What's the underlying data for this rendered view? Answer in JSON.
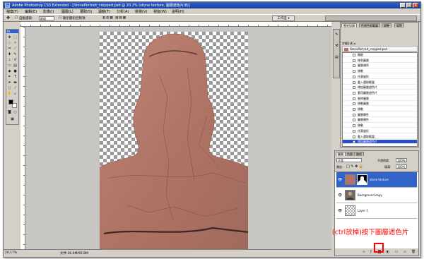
{
  "window": {
    "title": "Adobe Photoshop CS3 Extended - [StonePortrait_cropped.psd @ 20.2% (stone texture, 圖層遮色片/8)]",
    "app_icon": "Ps",
    "controls": [
      "_",
      "□",
      "×"
    ]
  },
  "menubar": {
    "items": [
      "檔案(F)",
      "編輯(E)",
      "影像(I)",
      "圖層(L)",
      "選取(S)",
      "濾鏡(T)",
      "分析(A)",
      "檢視(V)",
      "視窗(W)",
      "說明(H)"
    ]
  },
  "options_bar": {
    "auto_select_label": "自動選取:",
    "auto_select_value": "群組",
    "transform_label": "顯示變形控制項",
    "workspace_label": "工作區 ▾"
  },
  "toolbox": {
    "header": "Ps"
  },
  "status_bar": {
    "zoom": "20.17%",
    "doc_info": "文件:36.4M/90.8M"
  },
  "history_panel": {
    "tabs": [
      "歷史記錄",
      "色版色彩範圍",
      "調整",
      "導覽"
    ],
    "snapshot_label": "步驟1(4) ▸",
    "file_name": "StonePortrait_cropped.psd",
    "steps": [
      "開啟",
      "移到圖層",
      "圖層順序",
      "移動",
      "任意變形",
      "載入選取範圍",
      "增加圖層遮色片",
      "套用圖層遮色片",
      "刪除圖層",
      "移動圖層",
      "移動",
      "圖層屬性",
      "圖層屬性",
      "移動",
      "任意變形",
      "載入選取範圍",
      "增加圖層遮色片"
    ],
    "selected_index": 16
  },
  "layers_panel": {
    "tabs": [
      "圖層",
      "色版",
      "路徑"
    ],
    "blend_mode": "正常",
    "opacity_label": "不透明度:",
    "opacity_value": "100%",
    "lock_label": "鎖定:",
    "fill_label": "填滿:",
    "fill_value": "100%",
    "layers": [
      {
        "name": "stone texture",
        "selected": true
      },
      {
        "name": "Background copy",
        "selected": false
      },
      {
        "name": "Layer 1",
        "selected": false
      }
    ]
  },
  "annotation": {
    "text": "(ctrl放掉)按下圖層遮色片",
    "color": "#ff0000"
  },
  "colors": {
    "title_bar": "#2f5fd0",
    "selection": "#3163c8",
    "stone": "#b07466"
  }
}
